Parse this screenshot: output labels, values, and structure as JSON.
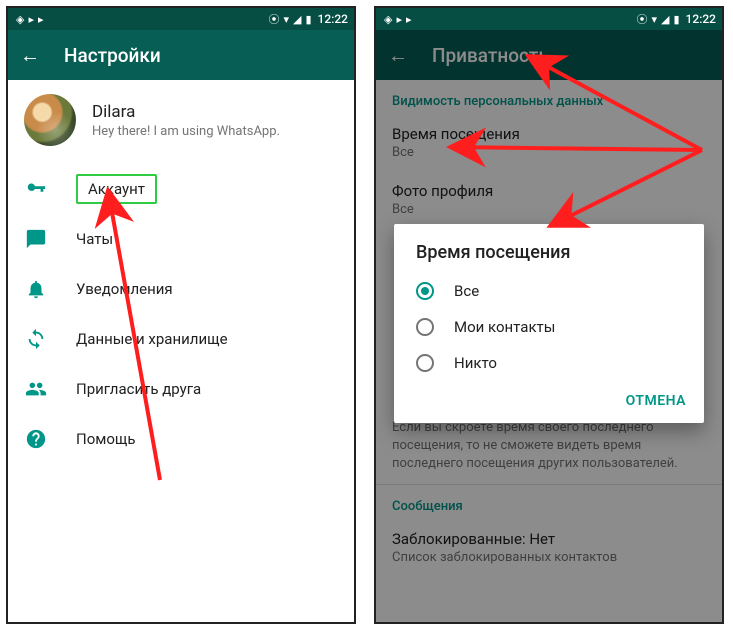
{
  "status": {
    "time": "12:22"
  },
  "left": {
    "appbar_title": "Настройки",
    "profile": {
      "name": "Dilara",
      "status": "Hey there! I am using WhatsApp."
    },
    "items": [
      {
        "key": "account",
        "label": "Аккаунт",
        "icon": "key-icon",
        "highlight": true
      },
      {
        "key": "chats",
        "label": "Чаты",
        "icon": "chat-icon",
        "highlight": false
      },
      {
        "key": "notif",
        "label": "Уведомления",
        "icon": "bell-icon",
        "highlight": false
      },
      {
        "key": "data",
        "label": "Данные и хранилище",
        "icon": "sync-icon",
        "highlight": false
      },
      {
        "key": "invite",
        "label": "Пригласить друга",
        "icon": "people-icon",
        "highlight": false
      },
      {
        "key": "help",
        "label": "Помощь",
        "icon": "help-icon",
        "highlight": false
      }
    ]
  },
  "right": {
    "appbar_title": "Приватность",
    "section1_title": "Видимость персональных данных",
    "prefs": [
      {
        "title": "Время посещения",
        "sub": "Все"
      },
      {
        "title": "Фото профиля",
        "sub": "Все"
      }
    ],
    "note": "Если вы скроете время своего последнего посещения, то не сможете видеть время последнего посещения других пользователей.",
    "section2_title": "Сообщения",
    "blocked": {
      "title": "Заблокированные: Нет",
      "sub": "Список заблокированных контактов"
    },
    "dialog": {
      "title": "Время посещения",
      "options": [
        {
          "label": "Все",
          "checked": true
        },
        {
          "label": "Мои контакты",
          "checked": false
        },
        {
          "label": "Никто",
          "checked": false
        }
      ],
      "cancel": "ОТМЕНА"
    }
  }
}
